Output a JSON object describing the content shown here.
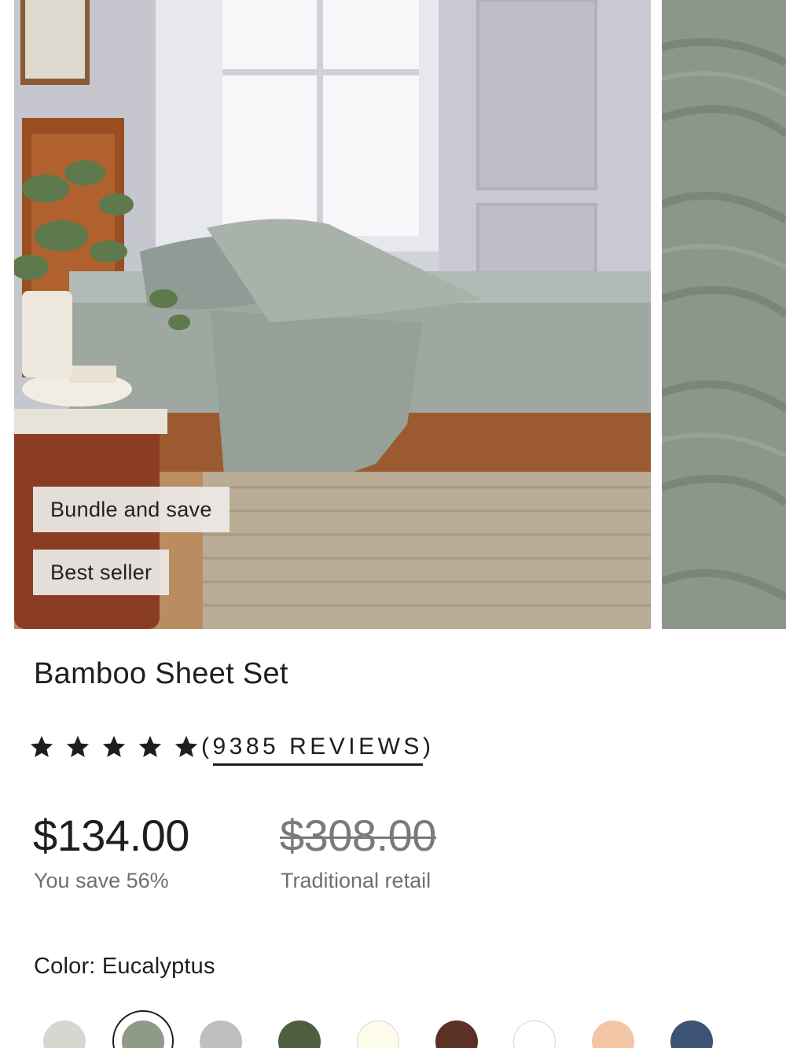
{
  "badges": {
    "bundle": "Bundle and save",
    "best_seller": "Best seller"
  },
  "product": {
    "title": "Bamboo Sheet Set",
    "rating_stars": 5,
    "reviews_open": "(",
    "reviews_label": "9385 REVIEWS",
    "reviews_close": ")"
  },
  "pricing": {
    "price": "$134.00",
    "savings": "You save 56%",
    "original_price": "$308.00",
    "original_label": "Traditional retail"
  },
  "color": {
    "label": "Color:",
    "selected": "Eucalyptus",
    "swatches": [
      {
        "name": "swatch-1",
        "hex": "#d8d7cf"
      },
      {
        "name": "swatch-2",
        "hex": "#8e9b86",
        "selected": true
      },
      {
        "name": "swatch-3",
        "hex": "#bdbfc1"
      },
      {
        "name": "swatch-4",
        "hex": "#4d5f3f"
      },
      {
        "name": "swatch-5",
        "hex": "#fdfbe9"
      },
      {
        "name": "swatch-6",
        "hex": "#5a3124"
      },
      {
        "name": "swatch-7",
        "hex": "#ffffff"
      },
      {
        "name": "swatch-8",
        "hex": "#f4c6a6"
      },
      {
        "name": "swatch-9",
        "hex": "#3d5374"
      }
    ]
  },
  "colors": {
    "text": "#1e1e1e",
    "muted": "#6f6f6f",
    "sheet": "#9aa59c"
  }
}
